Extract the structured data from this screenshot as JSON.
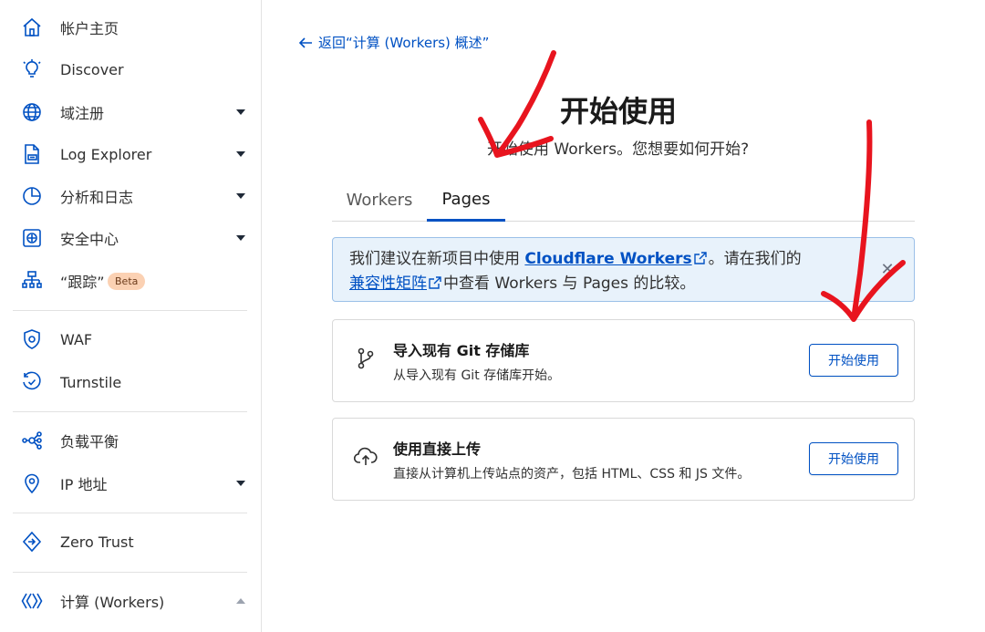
{
  "sidebar": {
    "items": [
      {
        "label": "帐户主页",
        "icon": "home-icon",
        "caret": ""
      },
      {
        "label": "Discover",
        "icon": "lightbulb-icon",
        "caret": ""
      },
      {
        "label": "域注册",
        "icon": "globe-icon",
        "caret": "down"
      },
      {
        "label": "Log Explorer",
        "icon": "log-icon",
        "caret": "down"
      },
      {
        "label": "分析和日志",
        "icon": "pie-chart-icon",
        "caret": "down"
      },
      {
        "label": "安全中心",
        "icon": "security-center-icon",
        "caret": "down"
      },
      {
        "label": "“跟踪”",
        "icon": "trace-icon",
        "caret": "",
        "badge": "Beta"
      },
      {
        "label": "WAF",
        "icon": "waf-shield-icon",
        "caret": ""
      },
      {
        "label": "Turnstile",
        "icon": "turnstile-icon",
        "caret": ""
      },
      {
        "label": "负载平衡",
        "icon": "load-balancer-icon",
        "caret": ""
      },
      {
        "label": "IP 地址",
        "icon": "location-pin-icon",
        "caret": "down"
      },
      {
        "label": "Zero Trust",
        "icon": "zero-trust-icon",
        "caret": ""
      },
      {
        "label": "计算 (Workers)",
        "icon": "workers-icon",
        "caret": "up"
      }
    ]
  },
  "back_link": "返回“计算 (Workers) 概述”",
  "title": "开始使用",
  "subtitle": "开始使用 Workers。您想要如何开始?",
  "tabs": [
    {
      "label": "Workers",
      "active": false
    },
    {
      "label": "Pages",
      "active": true
    }
  ],
  "info": {
    "prefix": "我们建议在新项目中使用 ",
    "link1": "Cloudflare Workers",
    "middle": "。请在我们的",
    "link2": "兼容性矩阵",
    "suffix": "中查看 Workers 与 Pages 的比较。"
  },
  "cards": [
    {
      "title": "导入现有 Git 存储库",
      "desc": "从导入现有 Git 存储库开始。",
      "button": "开始使用",
      "icon": "git-branch-icon"
    },
    {
      "title": "使用直接上传",
      "desc": "直接从计算机上传站点的资产，包括 HTML、CSS 和 JS 文件。",
      "button": "开始使用",
      "icon": "cloud-upload-icon"
    }
  ],
  "colors": {
    "accent": "#0051c3",
    "annotation": "#e8141e",
    "badge": "#fbd1b3"
  }
}
